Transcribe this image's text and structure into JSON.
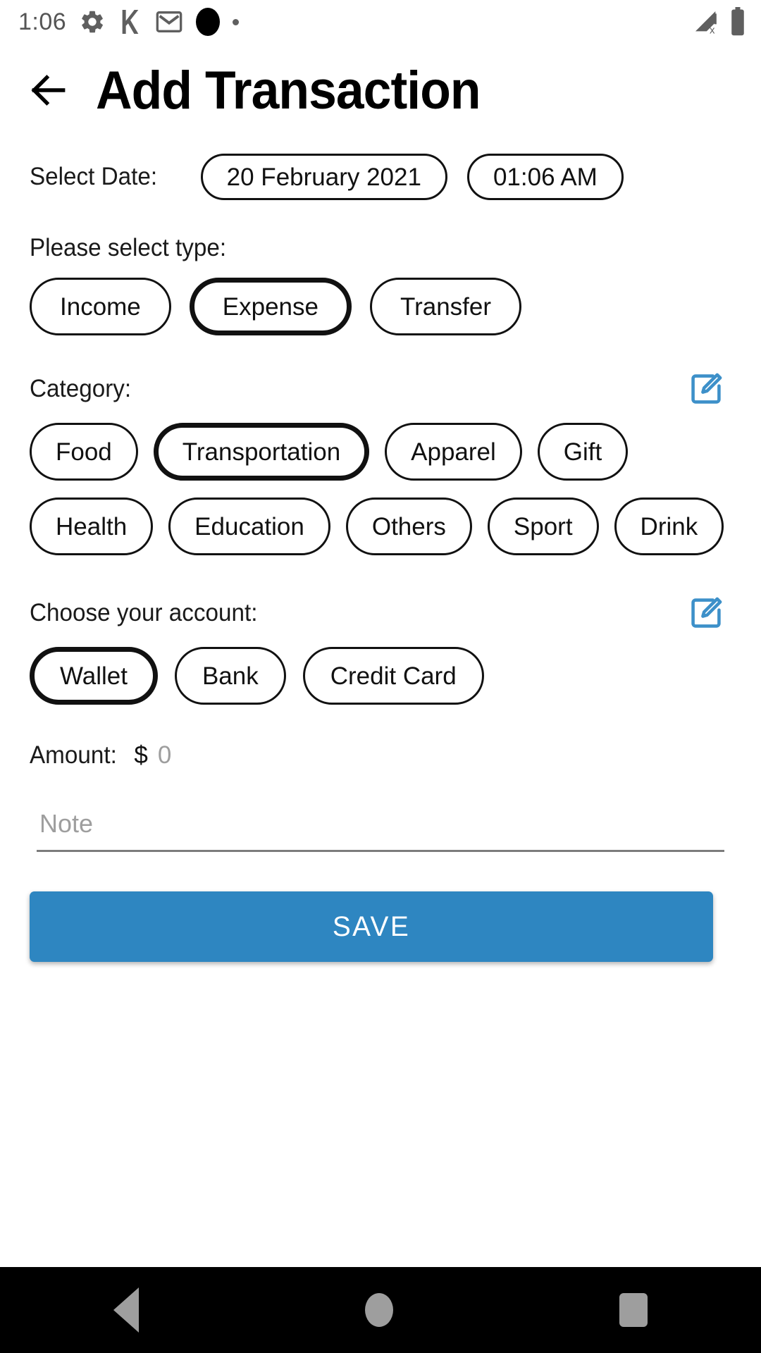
{
  "status_bar": {
    "clock": "1:06",
    "left_icons": [
      "gear-icon",
      "k-app-icon",
      "gmail-icon",
      "black-circle-icon",
      "small-dot-icon"
    ],
    "right_icons": [
      "signal-no-service-icon",
      "battery-icon"
    ]
  },
  "app_bar": {
    "back_label": "back-arrow",
    "title": "Add Transaction"
  },
  "date_section": {
    "label": "Select Date:",
    "date_value": "20 February 2021",
    "time_value": "01:06 AM"
  },
  "type_section": {
    "label": "Please select type:",
    "options": [
      "Income",
      "Expense",
      "Transfer"
    ],
    "selected": "Expense"
  },
  "category_section": {
    "label": "Category:",
    "edit_icon": "edit-icon",
    "options": [
      "Food",
      "Transportation",
      "Apparel",
      "Gift",
      "Health",
      "Education",
      "Others",
      "Sport",
      "Drink"
    ],
    "selected": "Transportation"
  },
  "account_section": {
    "label": "Choose your account:",
    "edit_icon": "edit-icon",
    "options": [
      "Wallet",
      "Bank",
      "Credit Card"
    ],
    "selected": "Wallet"
  },
  "amount_section": {
    "label": "Amount:",
    "currency": "$",
    "value": "0"
  },
  "note_section": {
    "placeholder": "Note",
    "value": ""
  },
  "save_button": {
    "label": "SAVE"
  },
  "nav_bar": {
    "back": "nav-back-icon",
    "home": "nav-home-icon",
    "recents": "nav-recents-icon"
  },
  "colors": {
    "accent": "#2e86c1",
    "edit_icon": "#3d90c9",
    "placeholder": "#9e9e9e",
    "border": "#111111"
  }
}
